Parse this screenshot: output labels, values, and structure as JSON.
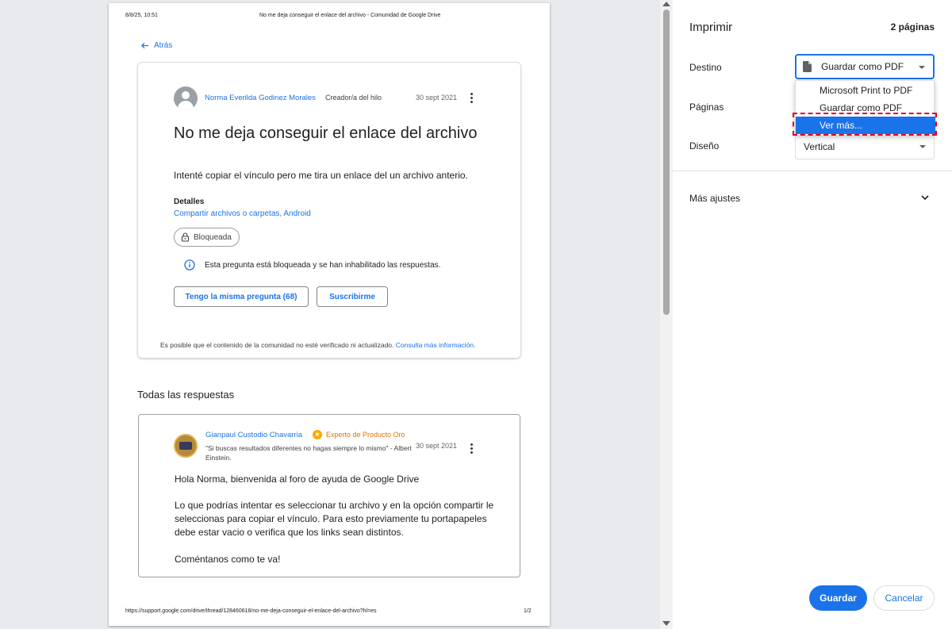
{
  "preview": {
    "header_date": "8/8/25, 10:51",
    "header_title": "No me deja conseguir el enlace del archivo - Comunidad de Google Drive",
    "footer_url": "https://support.google.com/drive/thread/128460618/no-me-deja-conseguir-el-enlace-del-archivo?hl=es",
    "footer_page": "1/2",
    "back_label": "Atrás",
    "question": {
      "author": "Norma Everilda Godinez Morales",
      "role": "Creador/a del hilo",
      "date": "30 sept 2021",
      "title": "No me deja conseguir el enlace del archivo",
      "body": "Intenté copiar el vínculo pero me tira un enlace del un archivo anterio.",
      "details_label": "Detalles",
      "details_links": "Compartir archivos o carpetas, Android",
      "locked_chip": "Bloqueada",
      "locked_info": "Esta pregunta está bloqueada y se han inhabilitado las respuestas.",
      "same_question_button": "Tengo la misma pregunta (68)",
      "subscribe_button": "Suscribirme",
      "disclaimer": "Es posible que el contenido de la comunidad no esté verificado ni actualizado.",
      "disclaimer_link": "Consulta más información."
    },
    "all_answers_heading": "Todas las respuestas",
    "answer": {
      "author": "Gianpaul Custodio Chavarria",
      "badge": "Experto de Producto Oro",
      "quote": "\"Si buscas resultados diferentes no hagas siempre lo mismo\" - Albert Einstein.",
      "date": "30 sept 2021",
      "p1": "Hola Norma, bienvenida al foro de ayuda de Google Drive",
      "p2": "Lo que podrías intentar es seleccionar tu archivo y en la opción compartir le seleccionas para copiar el vínculo. Para esto previamente tu portapapeles debe estar vacio o verifica que los links sean distintos.",
      "p3": "Coméntanos como te va!"
    }
  },
  "panel": {
    "title": "Imprimir",
    "pages_count": "2 páginas",
    "destination_label": "Destino",
    "destination_value": "Guardar como PDF",
    "pages_label": "Páginas",
    "layout_label": "Diseño",
    "layout_value": "Vertical",
    "dropdown_options": [
      "Microsoft Print to PDF",
      "Guardar como PDF",
      "Ver más..."
    ],
    "more_settings": "Más ajustes",
    "save_button": "Guardar",
    "cancel_button": "Cancelar"
  },
  "colors": {
    "accent": "#1a73e8",
    "highlight": "#e0001b",
    "expert": "#e37400"
  }
}
